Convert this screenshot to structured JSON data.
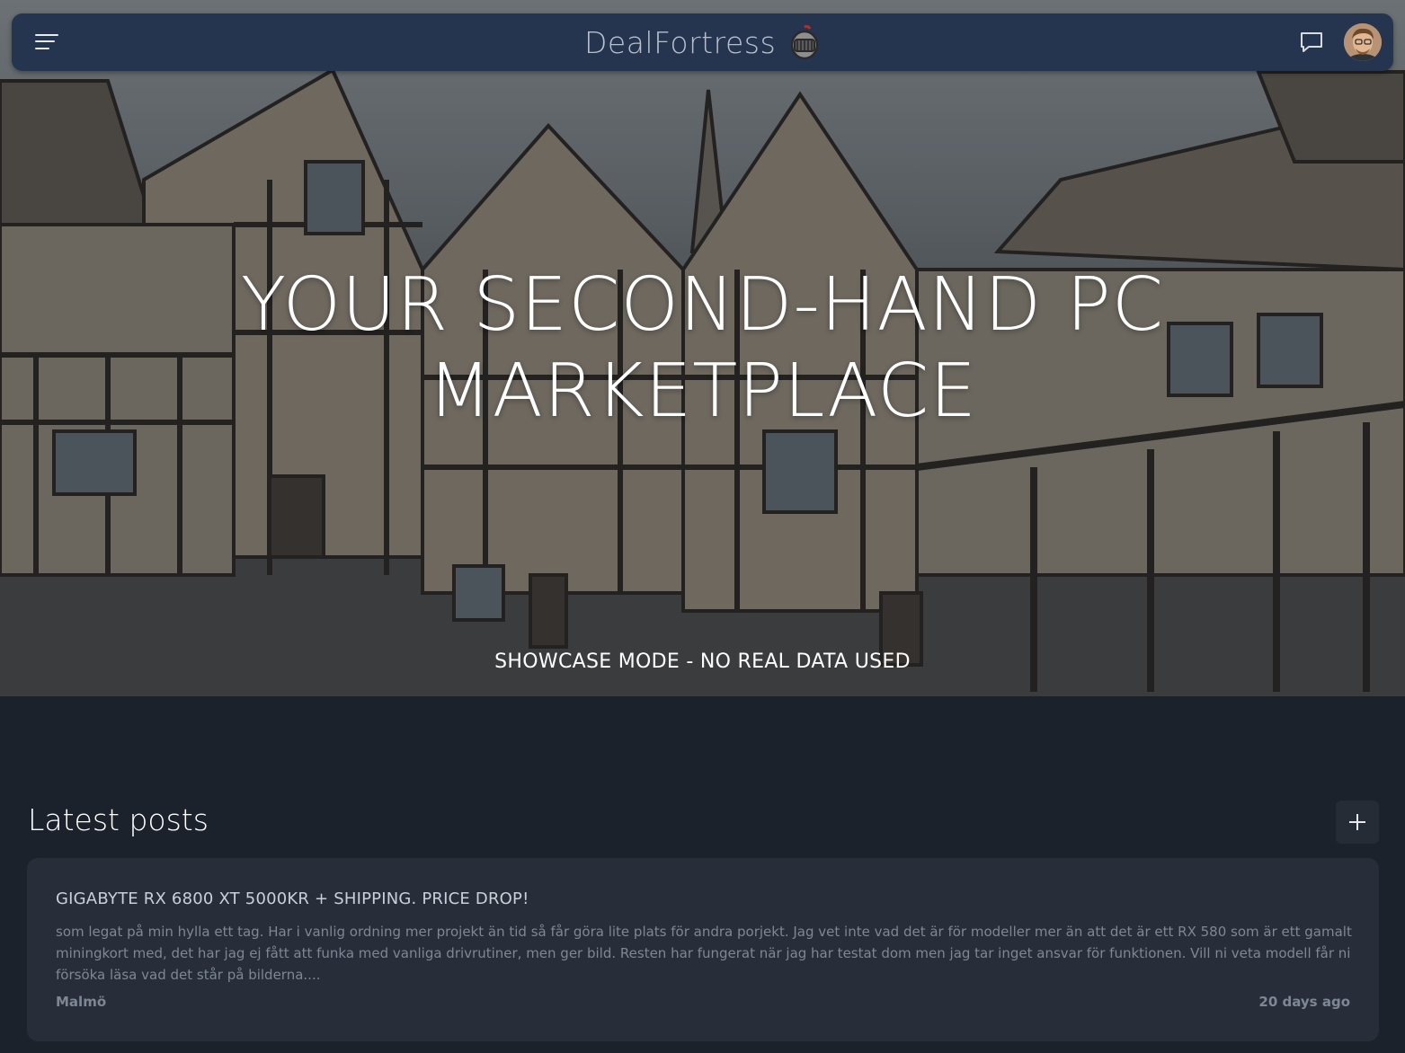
{
  "navbar": {
    "brand_name": "DealFortress",
    "menu_icon": "hamburger-menu-icon",
    "chat_icon": "chat-bubble-icon",
    "logo_icon": "knight-helmet-icon",
    "avatar_icon": "user-avatar"
  },
  "hero": {
    "title_line1": "YOUR SECOND-HAND PC",
    "title_line2": "MARKETPLACE",
    "showcase_text": "SHOWCASE MODE - NO REAL DATA USED"
  },
  "latest": {
    "title": "Latest posts",
    "add_icon": "plus-icon"
  },
  "posts": [
    {
      "title": "GIGABYTE RX 6800 XT 5000KR + SHIPPING. PRICE DROP!",
      "body": "som legat på min hylla ett tag. Har i vanlig ordning mer projekt än tid så får göra lite plats för andra porjekt. Jag vet inte vad det är för modeller mer än att det är ett RX 580 som är ett gamalt miningkort med, det har jag ej fått att funka med vanliga drivrutiner, men ger bild. Resten har fungerat när jag har testat dom men jag tar inget ansvar för funktionen. Vill ni veta modell får ni försöka läsa vad det står på bilderna....",
      "location": "Malmö",
      "time": "20 days ago"
    }
  ],
  "colors": {
    "navbar_bg": "#26354f",
    "page_bg": "#1c222c",
    "card_bg": "#272e39"
  }
}
